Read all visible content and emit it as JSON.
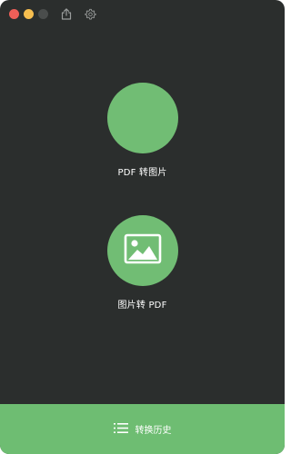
{
  "window": {
    "background_color": "#2b2e2d",
    "accent_color": "#71bd74"
  },
  "titlebar": {
    "traffic_lights": [
      "close",
      "minimize",
      "maximize"
    ],
    "icons": [
      "share-icon",
      "settings-icon"
    ]
  },
  "actions": [
    {
      "label": "PDF 转图片",
      "icon": "none"
    },
    {
      "label": "图片转 PDF",
      "icon": "image-icon"
    }
  ],
  "bottom_bar": {
    "label": "转换历史",
    "icon": "list-icon",
    "background_color": "#6ebd72"
  }
}
